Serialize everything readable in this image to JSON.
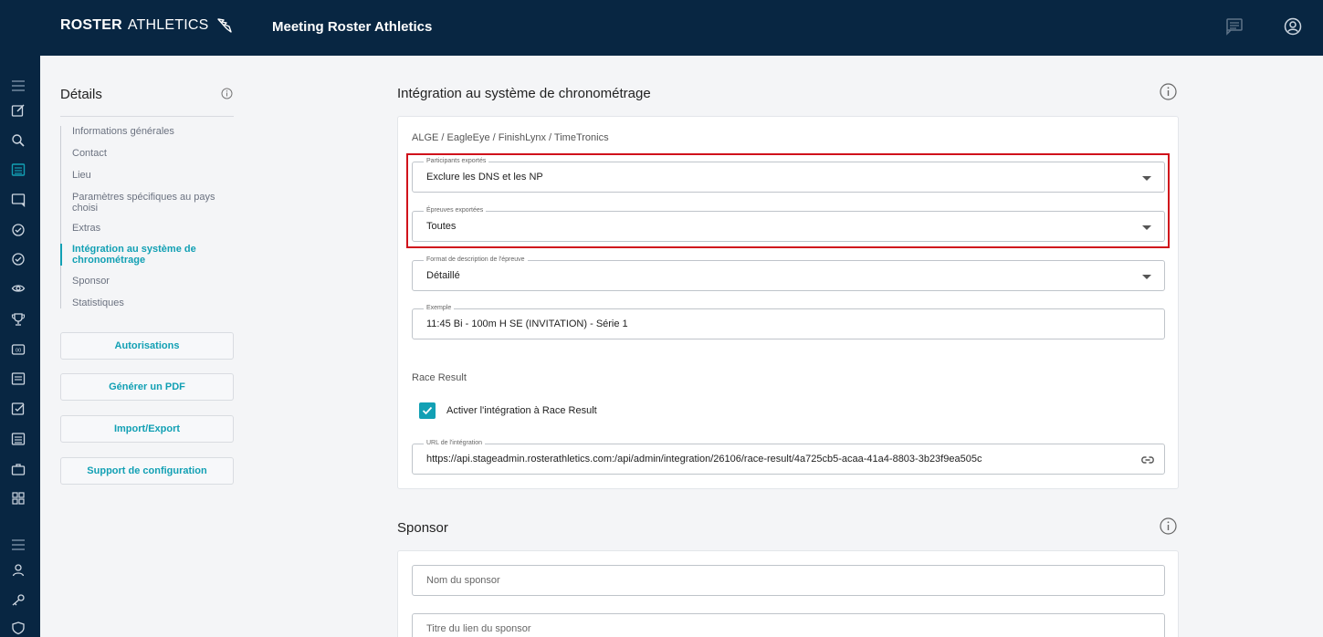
{
  "header": {
    "brand_bold": "ROSTER",
    "brand_light": "ATHLETICS",
    "title": "Meeting Roster Athletics",
    "icons": [
      "chat-icon",
      "account-icon"
    ]
  },
  "rail": {
    "icons": [
      "menu-icon",
      "edit-icon",
      "search-icon",
      "list-icon",
      "message-icon",
      "check-circle-icon",
      "check-circle-icon",
      "eye-icon",
      "trophy-icon",
      "scoreboard-icon",
      "document-icon",
      "checkbox-icon",
      "list-icon",
      "briefcase-icon",
      "grid-icon",
      "menu-icon",
      "person-icon",
      "key-icon",
      "shield-icon"
    ]
  },
  "details": {
    "title": "Détails",
    "nav": [
      {
        "label": "Informations générales"
      },
      {
        "label": "Contact"
      },
      {
        "label": "Lieu"
      },
      {
        "label": "Paramètres spécifiques au pays choisi"
      },
      {
        "label": "Extras"
      },
      {
        "label": "Intégration au système de chronométrage",
        "active": true
      },
      {
        "label": "Sponsor"
      },
      {
        "label": "Statistiques"
      }
    ],
    "buttons": {
      "permissions": "Autorisations",
      "pdf": "Générer un PDF",
      "import_export": "Import/Export",
      "support": "Support de configuration"
    }
  },
  "timing": {
    "title": "Intégration au système de chronométrage",
    "systems_label": "ALGE / EagleEye / FinishLynx / TimeTronics",
    "participants": {
      "label": "Participants exportés",
      "value": "Exclure les DNS et les NP"
    },
    "events": {
      "label": "Épreuves exportées",
      "value": "Toutes"
    },
    "format": {
      "label": "Format de description de l'épreuve",
      "value": "Détaillé"
    },
    "example": {
      "label": "Exemple",
      "value": "11:45 Bi - 100m H SE (INVITATION) - Série 1"
    },
    "race_result_label": "Race Result",
    "race_result_checkbox": {
      "label": "Activer l'intégration à Race Result",
      "checked": true
    },
    "url": {
      "label": "URL de l'intégration",
      "value": "https://api.stageadmin.rosterathletics.com:/api/admin/integration/26106/race-result/4a725cb5-acaa-41a4-8803-3b23f9ea505c"
    }
  },
  "sponsor": {
    "title": "Sponsor",
    "name_placeholder": "Nom du sponsor",
    "link_title_placeholder": "Titre du lien du sponsor"
  },
  "colors": {
    "navy": "#082642",
    "teal": "#12a0b4",
    "highlight": "#d0121b"
  }
}
